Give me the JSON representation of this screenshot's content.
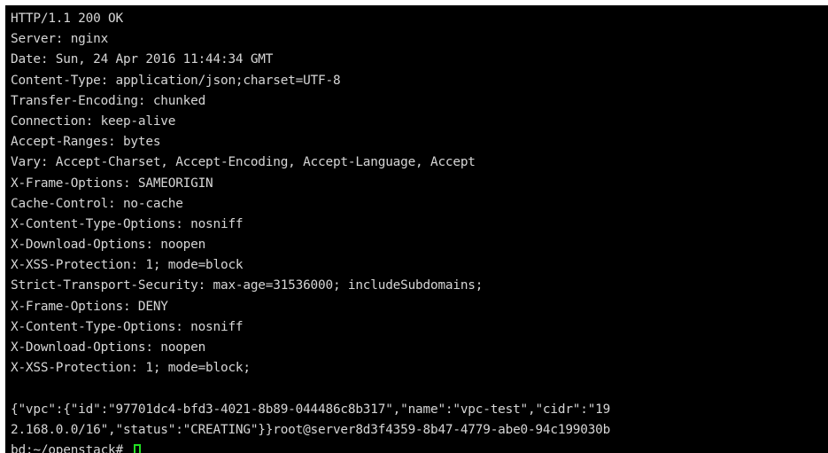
{
  "terminal": {
    "lines": [
      "HTTP/1.1 200 OK",
      "Server: nginx",
      "Date: Sun, 24 Apr 2016 11:44:34 GMT",
      "Content-Type: application/json;charset=UTF-8",
      "Transfer-Encoding: chunked",
      "Connection: keep-alive",
      "Accept-Ranges: bytes",
      "Vary: Accept-Charset, Accept-Encoding, Accept-Language, Accept",
      "X-Frame-Options: SAMEORIGIN",
      "Cache-Control: no-cache",
      "X-Content-Type-Options: nosniff",
      "X-Download-Options: noopen",
      "X-XSS-Protection: 1; mode=block",
      "Strict-Transport-Security: max-age=31536000; includeSubdomains;",
      "X-Frame-Options: DENY",
      "X-Content-Type-Options: nosniff",
      "X-Download-Options: noopen",
      "X-XSS-Protection: 1; mode=block;",
      "",
      "{\"vpc\":{\"id\":\"97701dc4-bfd3-4021-8b89-044486c8b317\",\"name\":\"vpc-test\",\"cidr\":\"19",
      "2.168.0.0/16\",\"status\":\"CREATING\"}}root@server8d3f4359-8b47-4779-abe0-94c199030b"
    ],
    "prompt": "bd:~/openstack# ",
    "colors": {
      "background": "#000000",
      "text": "#d6d6d6",
      "cursor": "#22e022"
    }
  }
}
